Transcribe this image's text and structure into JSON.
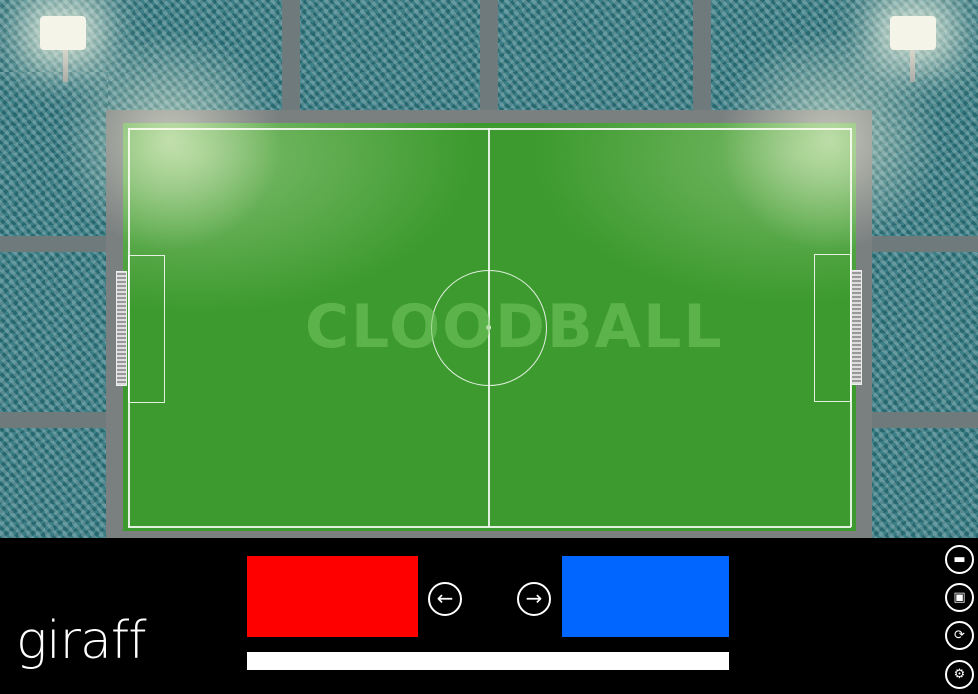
{
  "field": {
    "watermark": "CLOODBALL"
  },
  "teams": {
    "home": {
      "color": "#ff0000"
    },
    "away": {
      "color": "#0066ff"
    }
  },
  "controls": {
    "left_arrow_icon": "←",
    "right_arrow_icon": "→"
  },
  "toolbar": {
    "open_icon": "folder-icon",
    "save_icon": "save-icon",
    "refresh_icon": "refresh-icon",
    "settings_icon": "gear-icon",
    "open_glyph": "▬",
    "save_glyph": "▣",
    "refresh_glyph": "⟳",
    "settings_glyph": "⚙"
  },
  "branding": {
    "logo": "giraff"
  }
}
